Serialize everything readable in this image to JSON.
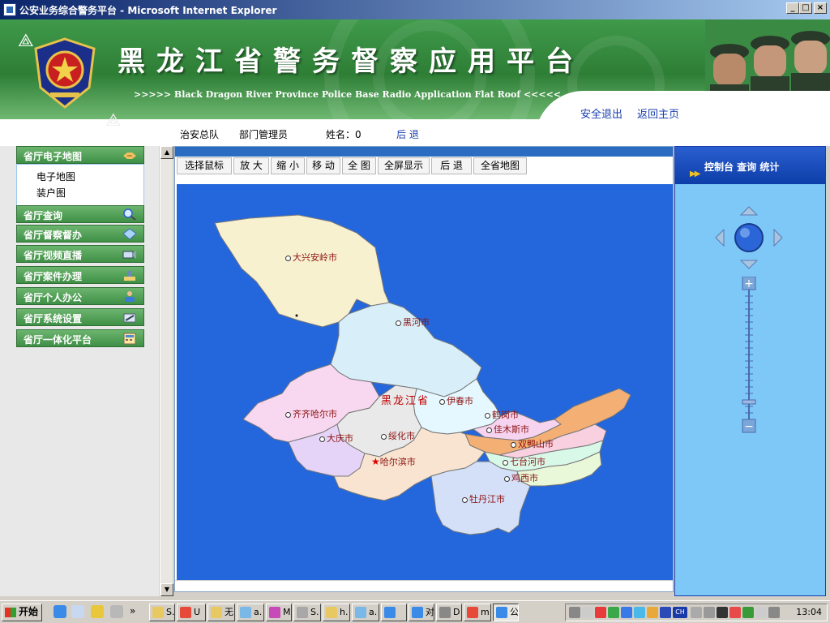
{
  "window": {
    "title": "公安业务综合警务平台 - Microsoft Internet Explorer",
    "min": "_",
    "max": "□",
    "close": "×"
  },
  "header": {
    "title": "黑龙江省警务督察应用平台",
    "subtitle": ">>>>> Black Dragon River Province Police Base Radio Application Flat Roof <<<<<",
    "logout": "安全退出",
    "home": "返回主页"
  },
  "userbar": {
    "unit": "治安总队",
    "role": "部门管理员",
    "name": "姓名：0",
    "back": "后 退"
  },
  "sidebar": {
    "items": [
      {
        "label": "省厅电子地图",
        "icon": "handshake-icon",
        "expanded": true
      },
      {
        "label": "省厅查询",
        "icon": "magnifier-icon"
      },
      {
        "label": "省厅督察督办",
        "icon": "gem-icon"
      },
      {
        "label": "省厅视频直播",
        "icon": "camera-icon"
      },
      {
        "label": "省厅案件办理",
        "icon": "stamp-icon"
      },
      {
        "label": "省厅个人办公",
        "icon": "person-icon"
      },
      {
        "label": "省厅系统设置",
        "icon": "tools-icon"
      },
      {
        "label": "省厅一体化平台",
        "icon": "calculator-icon"
      }
    ],
    "submenu": [
      "电子地图",
      "装户图"
    ]
  },
  "toolbar": {
    "tools": [
      "选择鼠标",
      "放 大",
      "缩 小",
      "移 动",
      "全 图",
      "全屏显示",
      "后 退",
      "全省地图"
    ]
  },
  "map": {
    "province_label": "黑龙江省",
    "capital": "哈尔滨市",
    "cities": [
      "大兴安岭市",
      "黑河市",
      "伊春市",
      "鹤岗市",
      "齐齐哈尔市",
      "佳木斯市",
      "大庆市",
      "绥化市",
      "双鸭山市",
      "七台河市",
      "鸡西市",
      "牡丹江市"
    ],
    "colors": {
      "water": "#2467dc"
    }
  },
  "control_panel": {
    "title": "控制台  查询  统计",
    "zoom_in": "+",
    "zoom_out": "−"
  },
  "taskbar": {
    "start": "开始",
    "chevron": "»",
    "tasks": [
      "S.",
      "U",
      "无",
      "a.",
      "M",
      "S.",
      "h.",
      "a.",
      "",
      "对",
      "D",
      "m",
      "公"
    ],
    "clock": "13:04",
    "ime": "CH"
  }
}
